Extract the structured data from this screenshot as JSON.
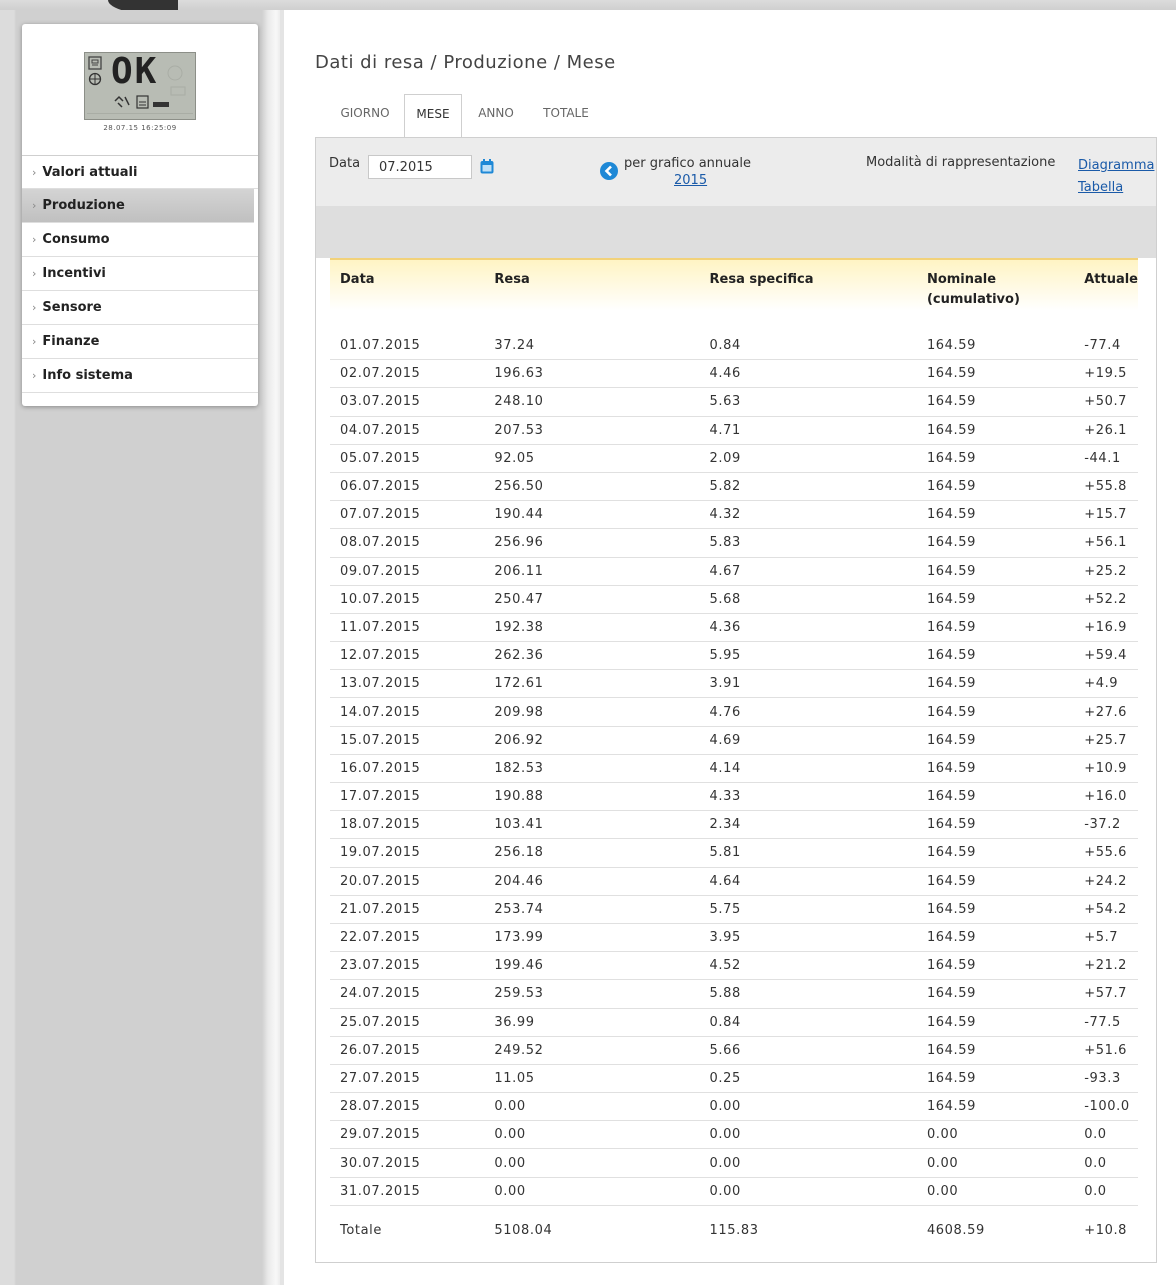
{
  "device": {
    "display_text": "OK",
    "timestamp": "28.07.15 16:25:09"
  },
  "sidebar": {
    "items": [
      {
        "label": "Valori attuali",
        "active": false
      },
      {
        "label": "Produzione",
        "active": true
      },
      {
        "label": "Consumo",
        "active": false
      },
      {
        "label": "Incentivi",
        "active": false
      },
      {
        "label": "Sensore",
        "active": false
      },
      {
        "label": "Finanze",
        "active": false
      },
      {
        "label": "Info sistema",
        "active": false
      }
    ]
  },
  "page": {
    "title": "Dati di resa / Produzione / Mese"
  },
  "tabs": [
    {
      "label": "GIORNO",
      "active": false
    },
    {
      "label": "MESE",
      "active": true
    },
    {
      "label": "ANNO",
      "active": false
    },
    {
      "label": "TOTALE",
      "active": false
    }
  ],
  "filter": {
    "date_label": "Data",
    "date_value": "07.2015",
    "annual_text": "per grafico annuale",
    "annual_link": "2015",
    "mode_label": "Modalità di rappresentazione",
    "mode_diagram": "Diagramma",
    "mode_table": "Tabella"
  },
  "colors": {
    "accent_link": "#1a5aa8",
    "header_border": "#f2d27a",
    "active_nav": "#c8c8c8"
  },
  "icons": {
    "calendar": "calendar-icon",
    "previous": "chevron-left-circle-icon",
    "menu_bullet": "chevron-right-icon"
  },
  "table": {
    "headers": [
      "Data",
      "Resa",
      "Resa specifica",
      "Nominale\n(cumulativo)",
      "Attuale"
    ],
    "rows": [
      [
        "01.07.2015",
        "37.24",
        "0.84",
        "164.59",
        "-77.4"
      ],
      [
        "02.07.2015",
        "196.63",
        "4.46",
        "164.59",
        "+19.5"
      ],
      [
        "03.07.2015",
        "248.10",
        "5.63",
        "164.59",
        "+50.7"
      ],
      [
        "04.07.2015",
        "207.53",
        "4.71",
        "164.59",
        "+26.1"
      ],
      [
        "05.07.2015",
        "92.05",
        "2.09",
        "164.59",
        "-44.1"
      ],
      [
        "06.07.2015",
        "256.50",
        "5.82",
        "164.59",
        "+55.8"
      ],
      [
        "07.07.2015",
        "190.44",
        "4.32",
        "164.59",
        "+15.7"
      ],
      [
        "08.07.2015",
        "256.96",
        "5.83",
        "164.59",
        "+56.1"
      ],
      [
        "09.07.2015",
        "206.11",
        "4.67",
        "164.59",
        "+25.2"
      ],
      [
        "10.07.2015",
        "250.47",
        "5.68",
        "164.59",
        "+52.2"
      ],
      [
        "11.07.2015",
        "192.38",
        "4.36",
        "164.59",
        "+16.9"
      ],
      [
        "12.07.2015",
        "262.36",
        "5.95",
        "164.59",
        "+59.4"
      ],
      [
        "13.07.2015",
        "172.61",
        "3.91",
        "164.59",
        "+4.9"
      ],
      [
        "14.07.2015",
        "209.98",
        "4.76",
        "164.59",
        "+27.6"
      ],
      [
        "15.07.2015",
        "206.92",
        "4.69",
        "164.59",
        "+25.7"
      ],
      [
        "16.07.2015",
        "182.53",
        "4.14",
        "164.59",
        "+10.9"
      ],
      [
        "17.07.2015",
        "190.88",
        "4.33",
        "164.59",
        "+16.0"
      ],
      [
        "18.07.2015",
        "103.41",
        "2.34",
        "164.59",
        "-37.2"
      ],
      [
        "19.07.2015",
        "256.18",
        "5.81",
        "164.59",
        "+55.6"
      ],
      [
        "20.07.2015",
        "204.46",
        "4.64",
        "164.59",
        "+24.2"
      ],
      [
        "21.07.2015",
        "253.74",
        "5.75",
        "164.59",
        "+54.2"
      ],
      [
        "22.07.2015",
        "173.99",
        "3.95",
        "164.59",
        "+5.7"
      ],
      [
        "23.07.2015",
        "199.46",
        "4.52",
        "164.59",
        "+21.2"
      ],
      [
        "24.07.2015",
        "259.53",
        "5.88",
        "164.59",
        "+57.7"
      ],
      [
        "25.07.2015",
        "36.99",
        "0.84",
        "164.59",
        "-77.5"
      ],
      [
        "26.07.2015",
        "249.52",
        "5.66",
        "164.59",
        "+51.6"
      ],
      [
        "27.07.2015",
        "11.05",
        "0.25",
        "164.59",
        "-93.3"
      ],
      [
        "28.07.2015",
        "0.00",
        "0.00",
        "164.59",
        "-100.0"
      ],
      [
        "29.07.2015",
        "0.00",
        "0.00",
        "0.00",
        "0.0"
      ],
      [
        "30.07.2015",
        "0.00",
        "0.00",
        "0.00",
        "0.0"
      ],
      [
        "31.07.2015",
        "0.00",
        "0.00",
        "0.00",
        "0.0"
      ]
    ],
    "total": [
      "Totale",
      "5108.04",
      "115.83",
      "4608.59",
      "+10.8"
    ]
  }
}
